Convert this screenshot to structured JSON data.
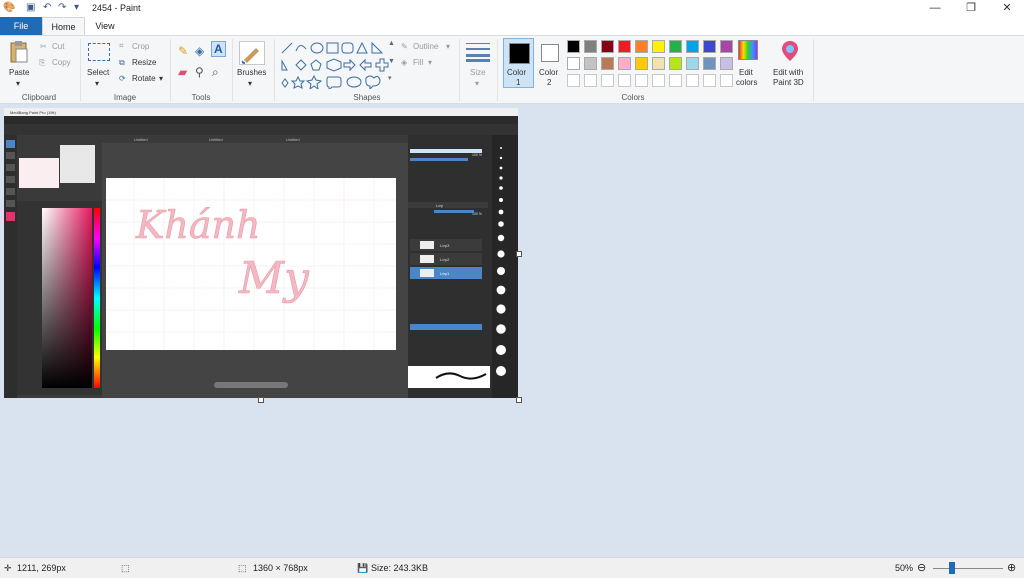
{
  "window": {
    "title": "2454 - Paint",
    "min_glyph": "—",
    "max_glyph": "❐",
    "close_glyph": "✕"
  },
  "tabs": {
    "file": "File",
    "home": "Home",
    "view": "View"
  },
  "ribbon": {
    "clipboard": {
      "paste": "Paste",
      "cut": "Cut",
      "copy": "Copy",
      "group": "Clipboard"
    },
    "image": {
      "select": "Select",
      "crop": "Crop",
      "resize": "Resize",
      "rotate": "Rotate",
      "group": "Image"
    },
    "tools": {
      "group": "Tools"
    },
    "brushes": {
      "label": "Brushes"
    },
    "shapes": {
      "outline": "Outline",
      "fill": "Fill",
      "group": "Shapes"
    },
    "size": {
      "label": "Size"
    },
    "colors": {
      "color1": "Color",
      "color1_num": "1",
      "color2": "Color",
      "color2_num": "2",
      "edit_colors": "Edit",
      "edit_colors2": "colors",
      "paint3d": "Edit with",
      "paint3d2": "Paint 3D",
      "group": "Colors",
      "palette_row1": [
        "#000000",
        "#7f7f7f",
        "#880015",
        "#ed1c24",
        "#ff7f27",
        "#fff200",
        "#22b14c",
        "#00a2e8",
        "#3f48cc",
        "#a349a4"
      ],
      "palette_row2": [
        "#ffffff",
        "#c3c3c3",
        "#b97a57",
        "#ffaec9",
        "#ffc90e",
        "#efe4b0",
        "#b5e61d",
        "#99d9ea",
        "#7092be",
        "#c8bfe7"
      ]
    }
  },
  "embedded": {
    "app_title": "MediBang Paint Pro (19it)",
    "canvas_text_1": "Khánh",
    "canvas_text_2": "My",
    "tab_labels": [
      "Untitled",
      "Untitled",
      "Untitled"
    ],
    "panel_layer": "Lớp",
    "layers": [
      "Lớp3",
      "Lớp2",
      "Lớp1"
    ],
    "pct_1": "100 %",
    "pct_2": "100 %"
  },
  "status": {
    "cursor": "1211, 269px",
    "dimensions": "1360 × 768px",
    "size": "Size: 243.3KB",
    "zoom": "50%"
  }
}
